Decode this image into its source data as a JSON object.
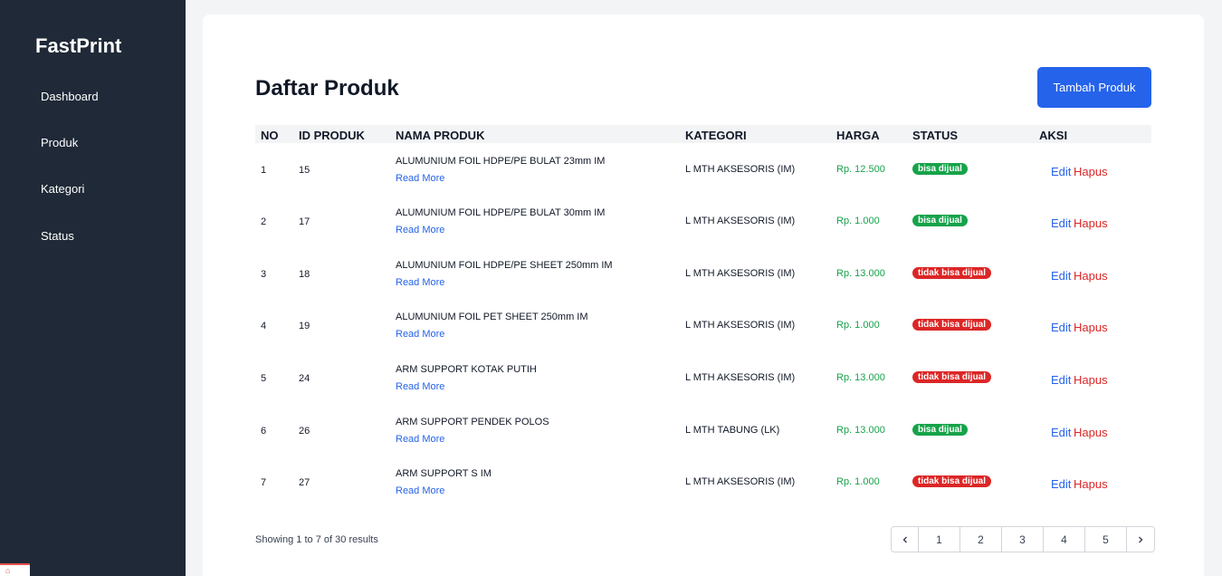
{
  "sidebar": {
    "brand": "FastPrint",
    "items": [
      {
        "label": "Dashboard"
      },
      {
        "label": "Produk"
      },
      {
        "label": "Kategori"
      },
      {
        "label": "Status"
      }
    ]
  },
  "header": {
    "title": "Daftar Produk",
    "add_button": "Tambah Produk"
  },
  "table": {
    "columns": [
      "NO",
      "ID PRODUK",
      "NAMA PRODUK",
      "KATEGORI",
      "HARGA",
      "STATUS",
      "AKSI"
    ],
    "read_more": "Read More",
    "edit_label": "Edit",
    "delete_label": "Hapus",
    "rows": [
      {
        "no": "1",
        "id": "15",
        "name": "ALUMUNIUM FOIL HDPE/PE BULAT 23mm IM",
        "category": "L MTH AKSESORIS (IM)",
        "price": "Rp. 12.500",
        "status": "bisa dijual"
      },
      {
        "no": "2",
        "id": "17",
        "name": "ALUMUNIUM FOIL HDPE/PE BULAT 30mm IM",
        "category": "L MTH AKSESORIS (IM)",
        "price": "Rp. 1.000",
        "status": "bisa dijual"
      },
      {
        "no": "3",
        "id": "18",
        "name": "ALUMUNIUM FOIL HDPE/PE SHEET 250mm IM",
        "category": "L MTH AKSESORIS (IM)",
        "price": "Rp. 13.000",
        "status": "tidak bisa dijual"
      },
      {
        "no": "4",
        "id": "19",
        "name": "ALUMUNIUM FOIL PET SHEET 250mm IM",
        "category": "L MTH AKSESORIS (IM)",
        "price": "Rp. 1.000",
        "status": "tidak bisa dijual"
      },
      {
        "no": "5",
        "id": "24",
        "name": "ARM SUPPORT KOTAK PUTIH",
        "category": "L MTH AKSESORIS (IM)",
        "price": "Rp. 13.000",
        "status": "tidak bisa dijual"
      },
      {
        "no": "6",
        "id": "26",
        "name": "ARM SUPPORT PENDEK POLOS",
        "category": "L MTH TABUNG (LK)",
        "price": "Rp. 13.000",
        "status": "bisa dijual"
      },
      {
        "no": "7",
        "id": "27",
        "name": "ARM SUPPORT S IM",
        "category": "L MTH AKSESORIS (IM)",
        "price": "Rp. 1.000",
        "status": "tidak bisa dijual"
      }
    ]
  },
  "footer": {
    "showing_prefix": "Showing",
    "from": "1",
    "to_word": "to",
    "to": "7",
    "of_word": "of",
    "total": "30",
    "results_word": "results",
    "pages": [
      "1",
      "2",
      "3",
      "4",
      "5"
    ],
    "prev_icon": "chevron-left-icon",
    "next_icon": "chevron-right-icon"
  },
  "colors": {
    "sidebar_bg": "#1f2937",
    "primary": "#2563eb",
    "success": "#16a34a",
    "danger": "#dc2626"
  }
}
